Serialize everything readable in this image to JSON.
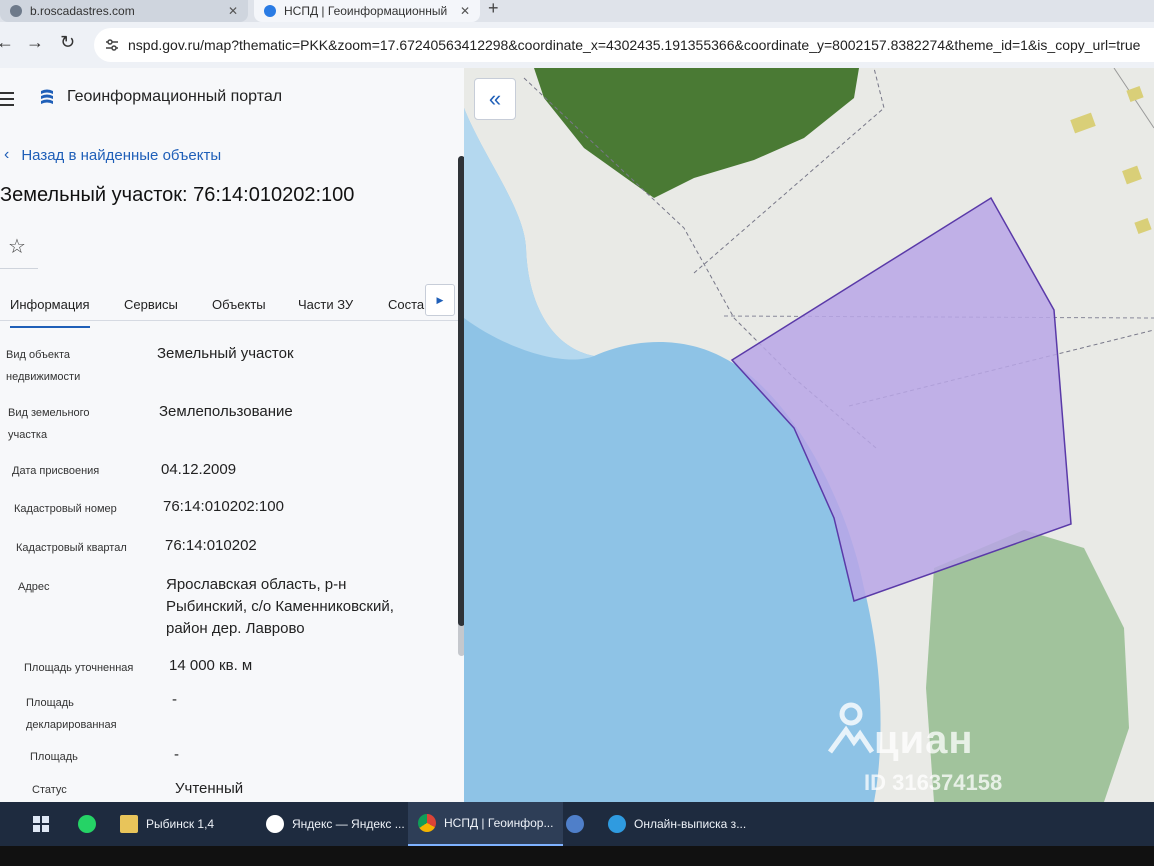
{
  "browser": {
    "tabs": [
      {
        "label": "b.roscadastres.com",
        "active": false
      },
      {
        "label": "НСПД | Геоинформационный",
        "active": true
      }
    ],
    "new_tab": "+",
    "url": "nspd.gov.ru/map?thematic=PKK&zoom=17.67240563412298&coordinate_x=4302435.191355366&coordinate_y=8002157.8382274&theme_id=1&is_copy_url=true"
  },
  "portal": {
    "title": "Геоинформационный портал",
    "back_link": "Назад в найденные объекты",
    "object_title": "Земельный участок: 76:14:010202:100"
  },
  "tabs": [
    "Информация",
    "Сервисы",
    "Объекты",
    "Части ЗУ",
    "Соста"
  ],
  "info": [
    {
      "label": [
        "Вид объекта",
        "недвижимости"
      ],
      "value": [
        "Земельный участок"
      ]
    },
    {
      "label": [
        "Вид земельного",
        "участка"
      ],
      "value": [
        "Землепользование"
      ]
    },
    {
      "label": [
        "Дата присвоения"
      ],
      "value": [
        "04.12.2009"
      ]
    },
    {
      "label": [
        "Кадастровый номер"
      ],
      "value": [
        "76:14:010202:100"
      ]
    },
    {
      "label": [
        "Кадастровый квартал"
      ],
      "value": [
        "76:14:010202"
      ]
    },
    {
      "label": [
        "Адрес"
      ],
      "value": [
        "Ярославская область, р-н",
        "Рыбинский, с/о Каменниковский,",
        "район дер. Лаврово"
      ]
    },
    {
      "label": [
        "Площадь уточненная"
      ],
      "value": [
        "14 000 кв. м"
      ]
    },
    {
      "label": [
        "Площадь",
        "декларированная"
      ],
      "value": [
        "-"
      ]
    },
    {
      "label": [
        "Площадь"
      ],
      "value": [
        "-"
      ]
    },
    {
      "label": [
        "Статус"
      ],
      "value": [
        "Учтенный"
      ]
    }
  ],
  "map": {
    "watermark": "циан",
    "watermark_id": "ID 316374158"
  },
  "taskbar": [
    {
      "label": "",
      "icon": "windows-icon"
    },
    {
      "label": "",
      "icon": "whatsapp-icon"
    },
    {
      "label": "Рыбинск 1,4",
      "icon": "folder-icon"
    },
    {
      "label": "Яндекс — Яндекс ...",
      "icon": "yandex-browser-icon"
    },
    {
      "label": "НСПД | Геоинфор...",
      "icon": "chrome-icon"
    },
    {
      "label": "",
      "icon": "app-icon"
    },
    {
      "label": "Онлайн-выписка з...",
      "icon": "edge-icon"
    }
  ],
  "colors": {
    "accent": "#1f5fb8",
    "parcel_fill": "#b9a6e6",
    "parcel_stroke": "#5a3aa8",
    "water": "#8ec3e6",
    "forest": "#4a7a34",
    "taskbar": "#1e2b3f"
  }
}
